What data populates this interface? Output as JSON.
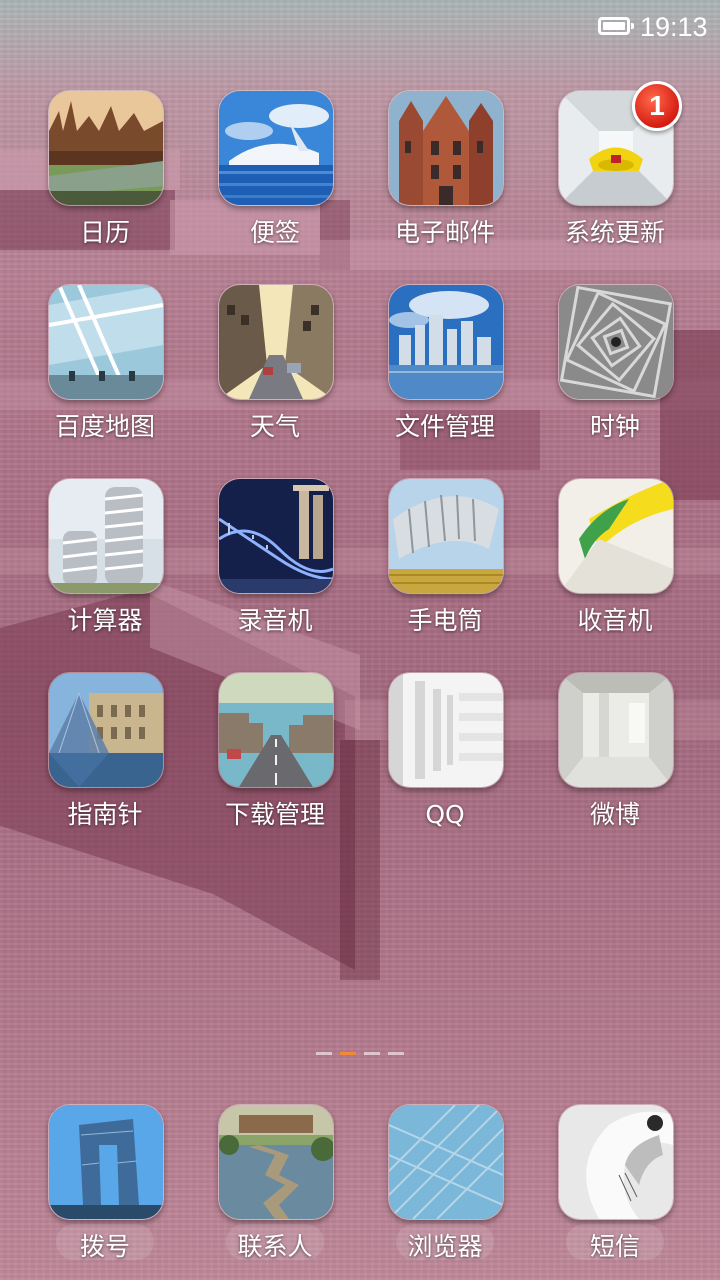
{
  "status_bar": {
    "time": "19:13",
    "battery_icon": "battery-icon"
  },
  "apps": [
    {
      "label": "日历",
      "icon": "london-parliament-photo-icon"
    },
    {
      "label": "便签",
      "icon": "modern-architecture-water-photo-icon"
    },
    {
      "label": "电子邮件",
      "icon": "gothic-building-photo-icon"
    },
    {
      "label": "系统更新",
      "icon": "futuristic-interior-photo-icon",
      "badge": "1"
    },
    {
      "label": "百度地图",
      "icon": "glass-atrium-photo-icon"
    },
    {
      "label": "天气",
      "icon": "city-street-photo-icon"
    },
    {
      "label": "文件管理",
      "icon": "skyline-reflection-photo-icon"
    },
    {
      "label": "时钟",
      "icon": "spiral-structure-photo-icon"
    },
    {
      "label": "计算器",
      "icon": "twisted-towers-photo-icon"
    },
    {
      "label": "录音机",
      "icon": "helix-bridge-photo-icon"
    },
    {
      "label": "手电筒",
      "icon": "curved-pavilion-photo-icon"
    },
    {
      "label": "收音机",
      "icon": "abstract-yellow-photo-icon"
    },
    {
      "label": "指南针",
      "icon": "louvre-pyramid-photo-icon"
    },
    {
      "label": "下载管理",
      "icon": "road-perspective-photo-icon"
    },
    {
      "label": "QQ",
      "icon": "white-corridor-photo-icon"
    },
    {
      "label": "微博",
      "icon": "white-room-photo-icon"
    }
  ],
  "dock": [
    {
      "label": "拨号",
      "icon": "cctv-tower-photo-icon"
    },
    {
      "label": "联系人",
      "icon": "garden-bridge-photo-icon"
    },
    {
      "label": "浏览器",
      "icon": "glass-facade-photo-icon"
    },
    {
      "label": "短信",
      "icon": "white-sculpture-photo-icon"
    }
  ],
  "page_indicator": {
    "pages": 4,
    "current": 2
  },
  "colors": {
    "badge": "#d61c12",
    "active_page_dot": "#f08a3a",
    "label_text": "#ffffff"
  }
}
